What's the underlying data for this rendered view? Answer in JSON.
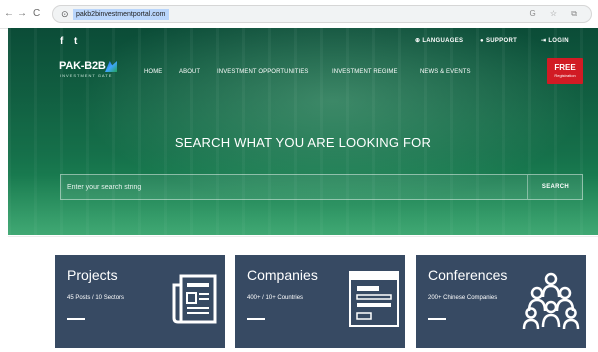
{
  "browser": {
    "back": "←",
    "forward": "→",
    "reload": "C",
    "url": "pakb2binvestmentportal.com",
    "url_icons": "G ☆ ⧉"
  },
  "topbar": {
    "facebook": "f",
    "twitter": "t",
    "languages": "LANGUAGES",
    "support": "SUPPORT",
    "login": "LOGIN"
  },
  "logo": {
    "main": "PAK-B2B",
    "sub": "INVESTMENT GATE"
  },
  "menu": {
    "home": "HOME",
    "about": "ABOUT",
    "investment_opportunities": "INVESTMENT OPPORTUNITIES",
    "investment_regime": "INVESTMENT REGIME",
    "news_events": "NEWS & EVENTS"
  },
  "free_badge": {
    "main": "FREE",
    "sub": "Registration"
  },
  "hero": {
    "title": "SEARCH WHAT YOU ARE LOOKING FOR",
    "search_placeholder": "Enter your search string",
    "search_button": "SEARCH"
  },
  "cards": [
    {
      "title": "Projects",
      "subtitle": "45 Posts / 10 Sectors",
      "icon": "newspaper-icon"
    },
    {
      "title": "Companies",
      "subtitle": "400+ / 10+ Countries",
      "icon": "company-window-icon"
    },
    {
      "title": "Conferences",
      "subtitle": "200+ Chinese Companies",
      "icon": "people-group-icon"
    }
  ]
}
